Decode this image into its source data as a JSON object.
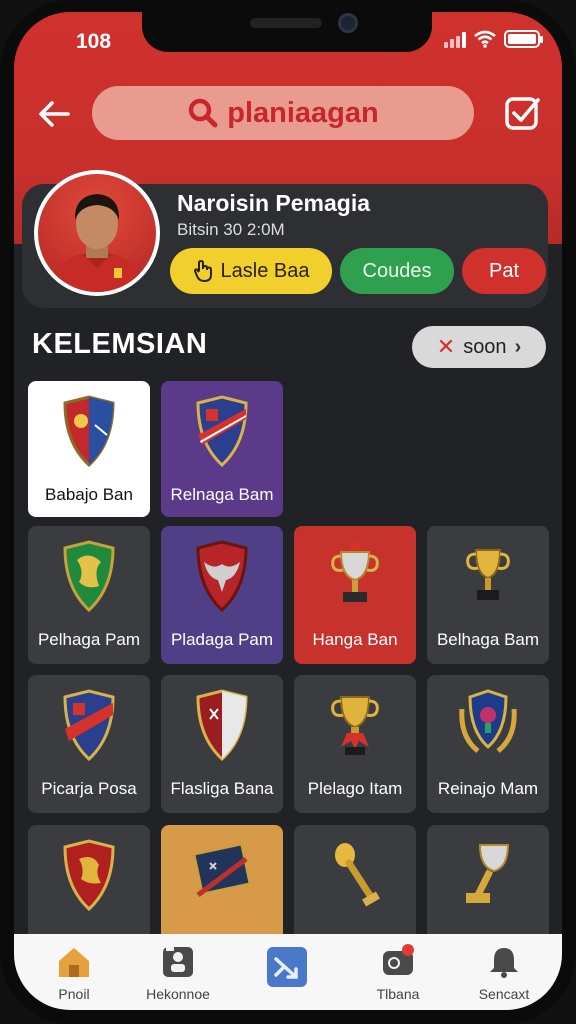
{
  "status_bar": {
    "time": "108"
  },
  "header": {
    "search_query": "planiaagan",
    "icons": [
      "back-arrow-icon",
      "search-icon",
      "checkbox-icon"
    ]
  },
  "profile": {
    "name": "Naroisin Pemagia",
    "subtitle": "Bitsin 30 2:0M",
    "buttons": {
      "yellow": "Lasle Baa",
      "green": "Coudes",
      "red": "Pat"
    }
  },
  "section": {
    "title": "KELEMSIAN",
    "filter_label": "soon"
  },
  "tiles": [
    {
      "label": "Babajo Ban",
      "icon": "red-blue-crest-icon"
    },
    {
      "label": "Relnaga Bam",
      "icon": "sash-crest-icon"
    },
    {
      "label": "Pelhaga Pam",
      "icon": "green-crest-icon"
    },
    {
      "label": "Pladaga Pam",
      "icon": "eagle-crest-icon"
    },
    {
      "label": "Hanga Ban",
      "icon": "silver-cup-icon"
    },
    {
      "label": "Belhaga Bam",
      "icon": "gold-cup-icon"
    },
    {
      "label": "Picarja Posa",
      "icon": "sash-crest-icon"
    },
    {
      "label": "Flasliga Bana",
      "icon": "red-crest-icon"
    },
    {
      "label": "Plelago Itam",
      "icon": "gold-cup-ribbon-icon"
    },
    {
      "label": "Reinajo Mam",
      "icon": "laurel-crest-icon"
    },
    {
      "label": "",
      "icon": "lion-crest-icon"
    },
    {
      "label": "",
      "icon": "flag-icon"
    },
    {
      "label": "",
      "icon": "gold-torch-icon"
    },
    {
      "label": "",
      "icon": "silver-gold-cup-icon"
    }
  ],
  "bottom_nav": [
    {
      "label": "Pnoil",
      "icon": "home-icon"
    },
    {
      "label": "Hekonnoe",
      "icon": "card-icon"
    },
    {
      "label": "",
      "icon": "shuffle-icon"
    },
    {
      "label": "Tlbana",
      "icon": "chat-icon"
    },
    {
      "label": "Sencaxt",
      "icon": "bell-icon"
    }
  ],
  "colors": {
    "accent_red": "#d0312d",
    "yellow": "#f1cf2c",
    "green": "#2fa04d",
    "background": "#212225"
  }
}
